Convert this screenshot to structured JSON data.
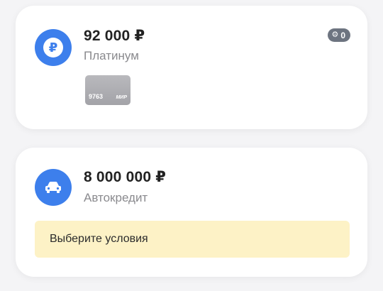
{
  "accounts": [
    {
      "amount": "92 000 ₽",
      "name": "Платинум",
      "icon": "ruble-icon",
      "icon_glyph": "₽",
      "bonus": {
        "icon": "gear-icon",
        "icon_glyph": "⚙",
        "count": "0"
      },
      "card": {
        "number": "9763",
        "brand": "МИР"
      }
    },
    {
      "amount": "8 000 000 ₽",
      "name": "Автокредит",
      "icon": "car-icon",
      "notice": "Выберите условия"
    }
  ],
  "colors": {
    "accent": "#3d7fec",
    "notice_bg": "#fdf2c6",
    "page_bg": "#f4f4f6"
  }
}
